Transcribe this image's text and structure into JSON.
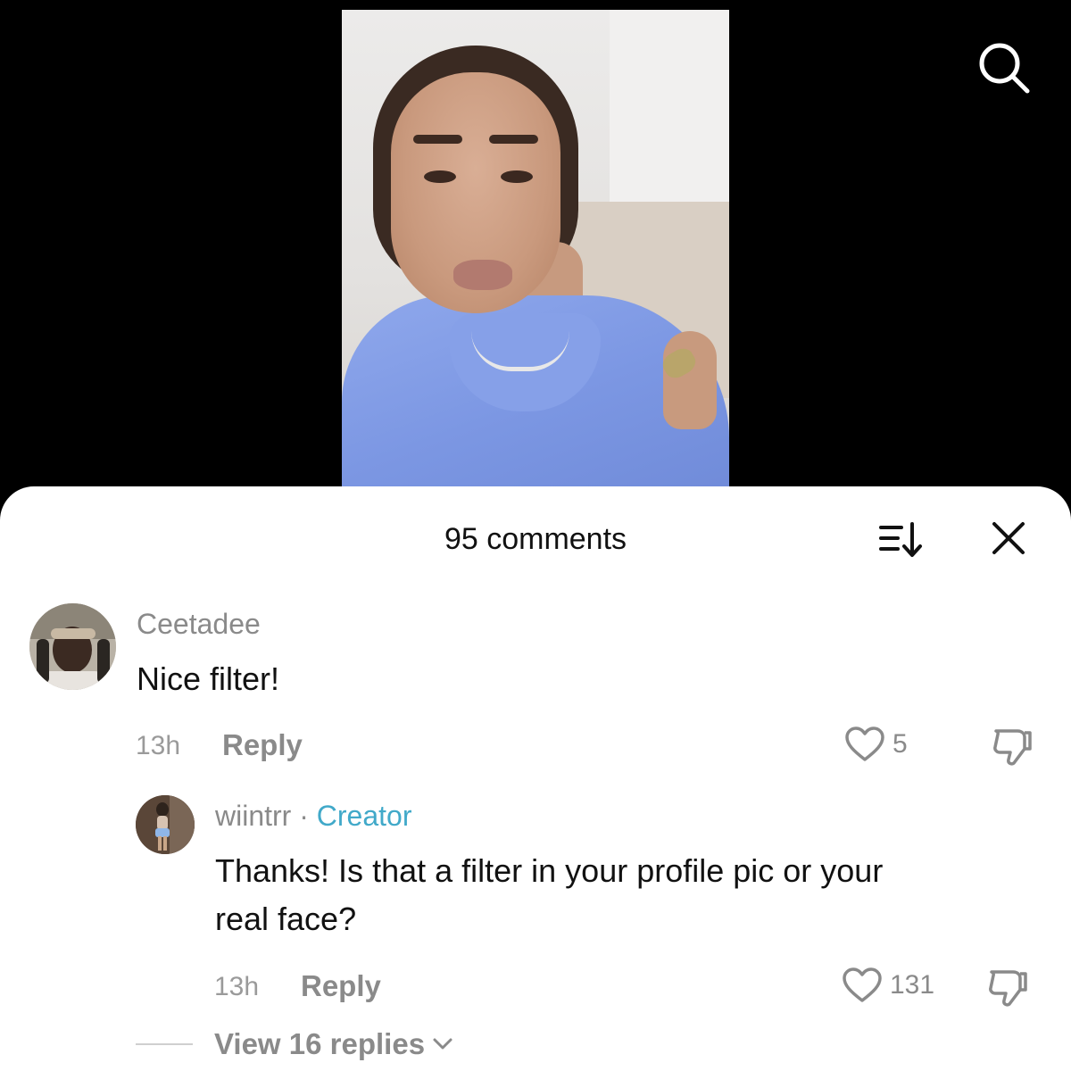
{
  "video": {
    "description_icon": "video-thumbnail"
  },
  "top_bar": {
    "search_icon": "search-icon"
  },
  "comments_sheet": {
    "title": "95 comments",
    "sort_icon": "sort-icon",
    "close_icon": "close-icon"
  },
  "comments": [
    {
      "username": "Ceetadee",
      "text": "Nice filter!",
      "time": "13h",
      "reply_label": "Reply",
      "likes": "5"
    },
    {
      "username": "wiintrr",
      "separator": "·",
      "badge": "Creator",
      "text_line1": "Thanks! Is that a filter in your profile pic or your",
      "text_line2": "real face?",
      "time": "13h",
      "reply_label": "Reply",
      "likes": "131"
    }
  ],
  "view_replies": "View 16 replies"
}
